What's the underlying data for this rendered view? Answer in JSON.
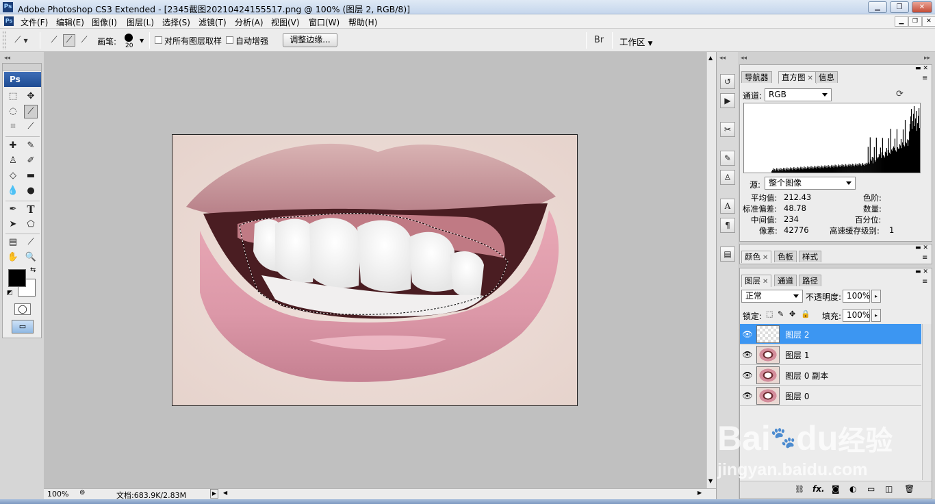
{
  "window": {
    "title": "Adobe Photoshop CS3 Extended - [2345截图20210424155517.png @ 100% (图层 2, RGB/8)]",
    "app_icon": "Ps"
  },
  "menu": [
    "文件(F)",
    "编辑(E)",
    "图像(I)",
    "图层(L)",
    "选择(S)",
    "滤镜(T)",
    "分析(A)",
    "视图(V)",
    "窗口(W)",
    "帮助(H)"
  ],
  "options": {
    "brush_label": "画笔:",
    "brush_size": "20",
    "sample_all_layers": "对所有图层取样",
    "auto_enhance": "自动增强",
    "refine_edge": "调整边缘...",
    "workspace": "工作区"
  },
  "toolbox": {
    "logo": "Ps"
  },
  "status": {
    "zoom": "100%",
    "doc": "文档:683.9K/2.83M"
  },
  "histogram": {
    "tabs": [
      "导航器",
      "直方图",
      "信息"
    ],
    "channel_label": "通道:",
    "channel": "RGB",
    "source_label": "源:",
    "source": "整个图像",
    "stats": {
      "mean_label": "平均值:",
      "mean": "212.43",
      "std_label": "标准偏差:",
      "std": "48.78",
      "median_label": "中间值:",
      "median": "234",
      "pixels_label": "像素:",
      "pixels": "42776",
      "level_label": "色阶:",
      "count_label": "数量:",
      "percentile_label": "百分位:",
      "cache_label": "高速缓存级别:",
      "cache": "1"
    }
  },
  "color_panel": {
    "tabs": [
      "颜色",
      "色板",
      "样式"
    ]
  },
  "layers_panel": {
    "tabs": [
      "图层",
      "通道",
      "路径"
    ],
    "blend_mode": "正常",
    "opacity_label": "不透明度:",
    "opacity": "100%",
    "lock_label": "锁定:",
    "fill_label": "填充:",
    "fill": "100%",
    "layers": [
      {
        "name": "图层 2",
        "active": true,
        "transparent": true
      },
      {
        "name": "图层 1",
        "active": false
      },
      {
        "name": "图层 0 副本",
        "active": false
      },
      {
        "name": "图层 0",
        "active": false
      }
    ]
  },
  "watermark": {
    "text1": "Bai",
    "text2": "du",
    "text3": "经验",
    "url": "jingyan.baidu.com"
  },
  "colors": {
    "accent": "#3c96f2",
    "title": "#1f4c93"
  }
}
